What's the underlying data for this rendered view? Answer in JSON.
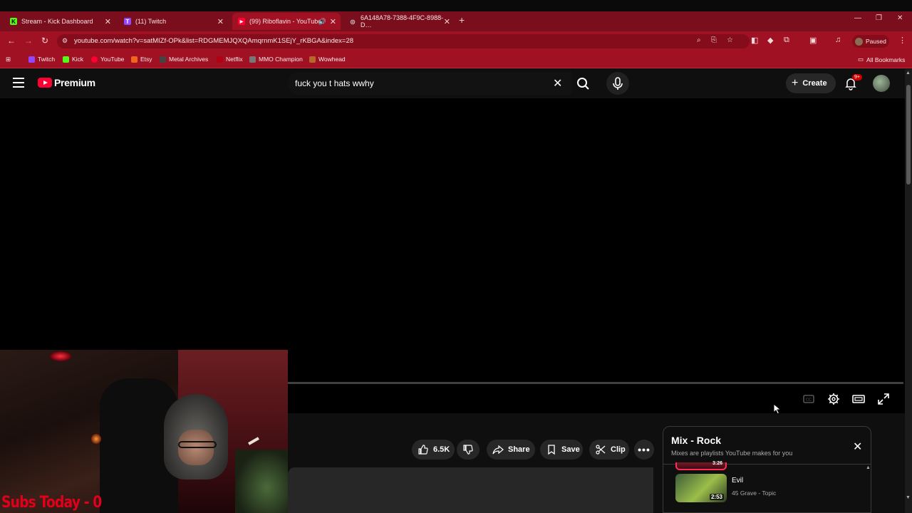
{
  "browser": {
    "tabs": [
      {
        "title": "Stream - Kick Dashboard",
        "favicon": "K",
        "favicon_color": "#53fc18"
      },
      {
        "title": "(11) Twitch",
        "favicon": "T",
        "favicon_color": "#9146ff"
      },
      {
        "title": "(99) Riboflavin - YouTube",
        "favicon": "▶",
        "favicon_color": "#ff0033",
        "active": true,
        "audio": "🔊"
      },
      {
        "title": "6A148A78-7388-4F9C-8988-D…",
        "favicon": "◎",
        "favicon_color": "#cccccc"
      }
    ],
    "url": "youtube.com/watch?v=satMIZf-OPk&list=RDGMEMJQXQAmqrnmK1SEjY_rKBGA&index=28",
    "profile_status": "Paused",
    "bookmarks": [
      "Twitch",
      "Kick",
      "YouTube",
      "Etsy",
      "Metal Archives",
      "Netflix",
      "MMO Champion",
      "Wowhead"
    ],
    "all_bookmarks": "All Bookmarks"
  },
  "youtube": {
    "logo_text": "Premium",
    "search_query": "fuck you t hats wwhy",
    "create_label": "Create",
    "notif_badge": "9+",
    "actions": {
      "likes": "6.5K",
      "share": "Share",
      "save": "Save",
      "clip": "Clip"
    },
    "mix": {
      "title": "Mix - Rock",
      "subtitle": "Mixes are playlists YouTube makes for you",
      "prev_duration": "3:26",
      "items": [
        {
          "title": "Evil",
          "artist": "45 Grave - Topic",
          "duration": "2:53"
        }
      ]
    }
  },
  "overlay": {
    "subs_text": "Subs Today - 0"
  }
}
